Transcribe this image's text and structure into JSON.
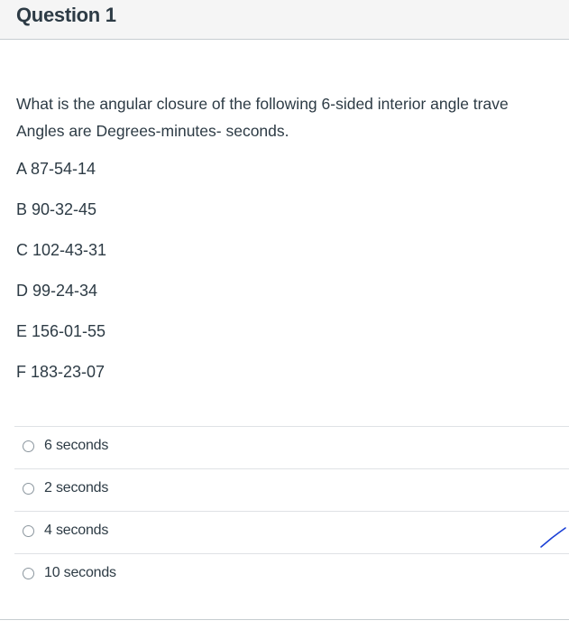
{
  "question": {
    "title": "Question 1",
    "text_line1": "What is the angular closure of the following 6-sided interior angle trave",
    "text_line2": "Angles are Degrees-minutes- seconds."
  },
  "angles": [
    "A 87-54-14",
    "B 90-32-45",
    "C 102-43-31",
    "D 99-24-34",
    "E 156-01-55",
    "F 183-23-07"
  ],
  "answers": [
    {
      "label": "6 seconds",
      "selected": false
    },
    {
      "label": "2 seconds",
      "selected": false
    },
    {
      "label": "4 seconds",
      "selected": false
    },
    {
      "label": "10 seconds",
      "selected": false
    }
  ],
  "annotation": {
    "mark_color": "#1a3fd6"
  }
}
